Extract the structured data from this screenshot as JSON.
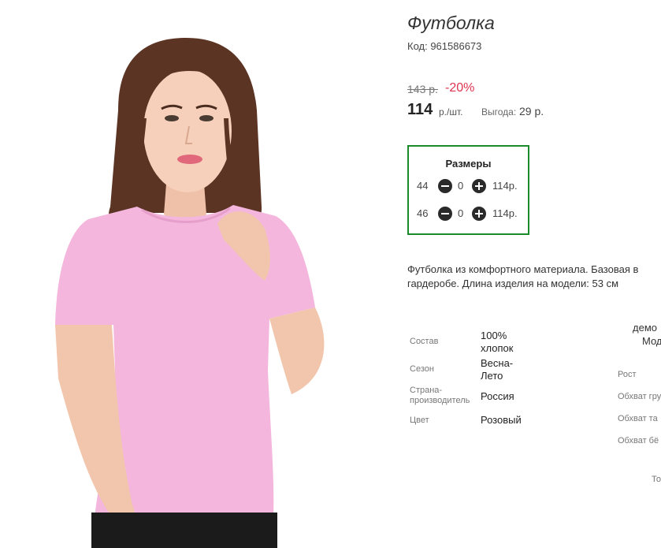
{
  "product": {
    "title": "Футболка",
    "code": "Код: 961586673",
    "old_price": "143 р.",
    "discount": "-20%",
    "price": "114",
    "unit": "р./шт.",
    "saving_label": "Выгода:",
    "saving_value": "29 р."
  },
  "sizes": {
    "title": "Размеры",
    "rows": [
      {
        "size": "44",
        "qty": "0",
        "price": "114р."
      },
      {
        "size": "46",
        "qty": "0",
        "price": "114р."
      }
    ]
  },
  "description": {
    "line1": "Футболка из комфортного материала. Базовая в",
    "line2": "гардеробе. Длина изделия на модели: 53 см"
  },
  "specs": [
    {
      "label": "Состав",
      "value": "100% хлопок"
    },
    {
      "label": "Сезон",
      "value": "Весна-Лето"
    },
    {
      "label": "Страна-производитель",
      "value": "Россия"
    },
    {
      "label": "Цвет",
      "value": "Розовый"
    }
  ],
  "model_params": {
    "demo_line1": "демо",
    "demo_line2": "Мод",
    "rows": [
      "Рост",
      "Обхват гру",
      "Обхват та",
      "Обхват бё"
    ],
    "footer": "То"
  },
  "colors": {
    "accent_green": "#1a8a2a",
    "discount_red": "#e0334f",
    "shirt_pink": "#f4b6dc"
  }
}
